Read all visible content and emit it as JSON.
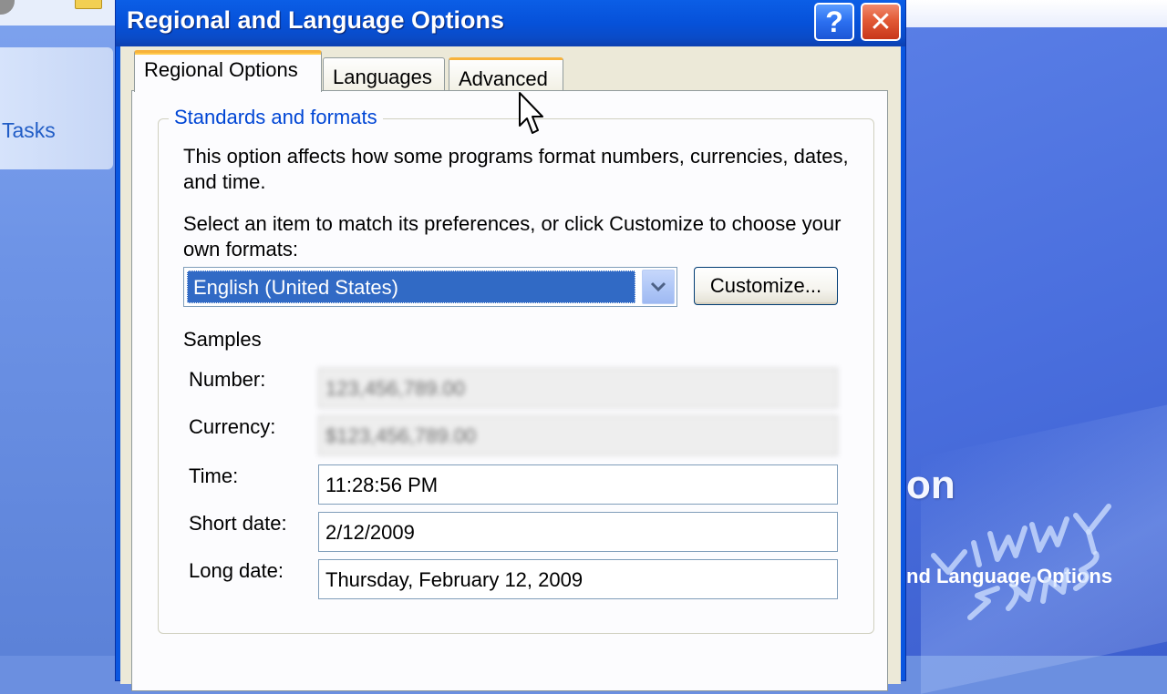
{
  "background": {
    "left_panel_link": "Tasks",
    "right_heading": "on",
    "right_subheading": "nd Language Options",
    "watermark_text": "JIMMY 3RUS"
  },
  "dialog": {
    "title": "Regional and Language Options",
    "help_glyph": "?",
    "close_glyph": "✕",
    "tabs": [
      {
        "label": "Regional Options",
        "active": true
      },
      {
        "label": "Languages",
        "active": false
      },
      {
        "label": "Advanced",
        "active": false
      }
    ],
    "standards": {
      "group_label": "Standards and formats",
      "description": "This option affects how some programs format numbers, currencies, dates, and time.",
      "instruction": "Select an item to match its preferences, or click Customize to choose your own formats:",
      "selected_locale": "English (United States)",
      "customize_label": "Customize...",
      "samples_label": "Samples",
      "samples": [
        {
          "label": "Number:",
          "value": "123,456,789.00",
          "blurred": true
        },
        {
          "label": "Currency:",
          "value": "$123,456,789.00",
          "blurred": true
        },
        {
          "label": "Time:",
          "value": "11:28:56 PM",
          "blurred": false
        },
        {
          "label": "Short date:",
          "value": "2/12/2009",
          "blurred": false
        },
        {
          "label": "Long date:",
          "value": "Thursday, February 12, 2009",
          "blurred": false
        }
      ]
    }
  },
  "colors": {
    "titlebar": "#0651d9",
    "selection": "#316ac5",
    "group_label": "#0046d5",
    "tab_highlight": "#f7b23b"
  },
  "icons": {
    "help": "question-mark-icon",
    "close": "close-icon",
    "dropdown": "chevron-down-icon",
    "cursor": "mouse-pointer-icon"
  }
}
